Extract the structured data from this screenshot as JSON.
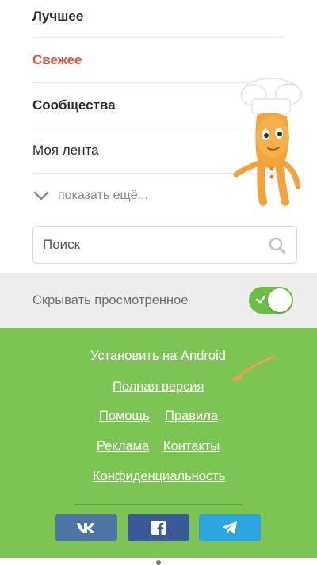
{
  "menu": {
    "items": [
      {
        "label": "Лучшее",
        "state": "bold"
      },
      {
        "label": "Свежее",
        "state": "active"
      },
      {
        "label": "Сообщества",
        "state": "bold"
      },
      {
        "label": "Моя лента",
        "state": "normal"
      }
    ],
    "show_more_label": "показать ещё..."
  },
  "search": {
    "placeholder": "Поиск"
  },
  "hide_viewed": {
    "label": "Скрывать просмотренное",
    "enabled": true
  },
  "footer": {
    "links": {
      "android": "Установить на Android",
      "full_version": "Полная версия",
      "help": "Помощь",
      "rules": "Правила",
      "ads": "Реклама",
      "contacts": "Контакты",
      "privacy": "Конфиденциальность"
    },
    "social": [
      {
        "name": "vk",
        "icon": "vk-icon"
      },
      {
        "name": "facebook",
        "icon": "facebook-icon"
      },
      {
        "name": "telegram",
        "icon": "telegram-icon"
      }
    ]
  },
  "colors": {
    "accent_red": "#d9533e",
    "footer_green": "#7cc454",
    "toggle_green": "#6cbd45",
    "vk": "#4d75a3",
    "facebook": "#3b5998",
    "telegram": "#2ca5e0",
    "annotation_arrow": "#f0a04b"
  }
}
